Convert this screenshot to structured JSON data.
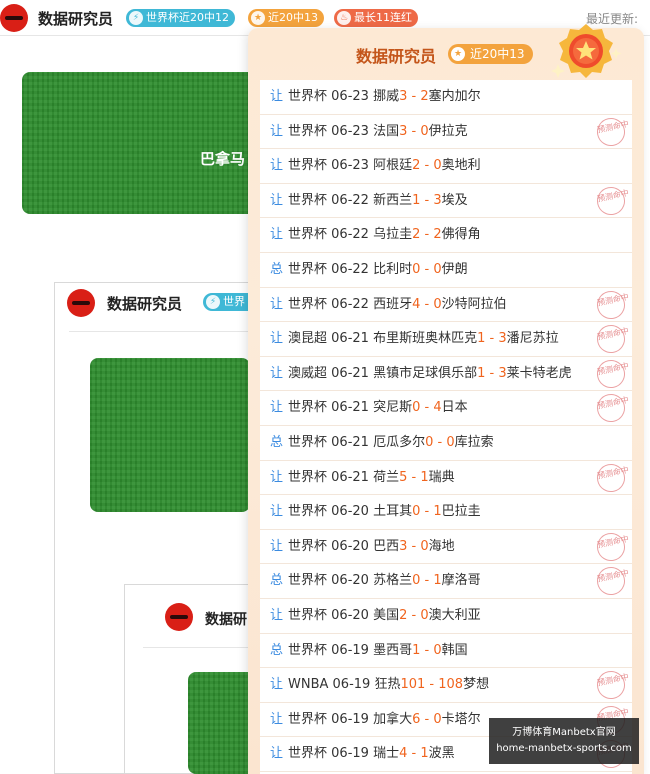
{
  "header": {
    "title": "数据研究员",
    "badges": [
      {
        "icon": "lightning-icon",
        "label": "世界杯近20中12"
      },
      {
        "icon": "star-icon",
        "label": "近20中13"
      },
      {
        "icon": "flame-icon",
        "label": "最长11连红"
      }
    ],
    "last_update": "最近更新:"
  },
  "background": {
    "banner_text": "巴拿马",
    "nested_frame_title": "数据研究员",
    "nested_frame_badge": "世界",
    "nested_frame2_title": "数据研"
  },
  "popup": {
    "title": "数据研究员",
    "badge": "近20中13",
    "stamp_text": "预测命中",
    "matches": [
      {
        "type": "让",
        "league": "世界杯",
        "date": "06-23",
        "home": "挪威",
        "hs": "3",
        "as": "2",
        "away": "塞内加尔",
        "hit": false
      },
      {
        "type": "让",
        "league": "世界杯",
        "date": "06-23",
        "home": "法国",
        "hs": "3",
        "as": "0",
        "away": "伊拉克",
        "hit": true
      },
      {
        "type": "让",
        "league": "世界杯",
        "date": "06-23",
        "home": "阿根廷",
        "hs": "2",
        "as": "0",
        "away": "奥地利",
        "hit": false
      },
      {
        "type": "让",
        "league": "世界杯",
        "date": "06-22",
        "home": "新西兰",
        "hs": "1",
        "as": "3",
        "away": "埃及",
        "hit": true
      },
      {
        "type": "让",
        "league": "世界杯",
        "date": "06-22",
        "home": "乌拉圭",
        "hs": "2",
        "as": "2",
        "away": "佛得角",
        "hit": false
      },
      {
        "type": "总",
        "league": "世界杯",
        "date": "06-22",
        "home": "比利时",
        "hs": "0",
        "as": "0",
        "away": "伊朗",
        "hit": false
      },
      {
        "type": "让",
        "league": "世界杯",
        "date": "06-22",
        "home": "西班牙",
        "hs": "4",
        "as": "0",
        "away": "沙特阿拉伯",
        "hit": true
      },
      {
        "type": "让",
        "league": "澳昆超",
        "date": "06-21",
        "home": "布里斯班奥林匹克",
        "hs": "1",
        "as": "3",
        "away": "潘尼苏拉",
        "hit": true
      },
      {
        "type": "让",
        "league": "澳威超",
        "date": "06-21",
        "home": "黑镇市足球俱乐部",
        "hs": "1",
        "as": "3",
        "away": "莱卡特老虎",
        "hit": true
      },
      {
        "type": "让",
        "league": "世界杯",
        "date": "06-21",
        "home": "突尼斯",
        "hs": "0",
        "as": "4",
        "away": "日本",
        "hit": true
      },
      {
        "type": "总",
        "league": "世界杯",
        "date": "06-21",
        "home": "厄瓜多尔",
        "hs": "0",
        "as": "0",
        "away": "库拉索",
        "hit": false
      },
      {
        "type": "让",
        "league": "世界杯",
        "date": "06-21",
        "home": "荷兰",
        "hs": "5",
        "as": "1",
        "away": "瑞典",
        "hit": true
      },
      {
        "type": "让",
        "league": "世界杯",
        "date": "06-20",
        "home": "土耳其",
        "hs": "0",
        "as": "1",
        "away": "巴拉圭",
        "hit": false
      },
      {
        "type": "让",
        "league": "世界杯",
        "date": "06-20",
        "home": "巴西",
        "hs": "3",
        "as": "0",
        "away": "海地",
        "hit": true
      },
      {
        "type": "总",
        "league": "世界杯",
        "date": "06-20",
        "home": "苏格兰",
        "hs": "0",
        "as": "1",
        "away": "摩洛哥",
        "hit": true
      },
      {
        "type": "让",
        "league": "世界杯",
        "date": "06-20",
        "home": "美国",
        "hs": "2",
        "as": "0",
        "away": "澳大利亚",
        "hit": false
      },
      {
        "type": "总",
        "league": "世界杯",
        "date": "06-19",
        "home": "墨西哥",
        "hs": "1",
        "as": "0",
        "away": "韩国",
        "hit": false
      },
      {
        "type": "让",
        "league": "WNBA",
        "date": "06-19",
        "home": "狂热",
        "hs": "101",
        "as": "108",
        "away": "梦想",
        "hit": true
      },
      {
        "type": "让",
        "league": "世界杯",
        "date": "06-19",
        "home": "加拿大",
        "hs": "6",
        "as": "0",
        "away": "卡塔尔",
        "hit": true
      },
      {
        "type": "让",
        "league": "世界杯",
        "date": "06-19",
        "home": "瑞士",
        "hs": "4",
        "as": "1",
        "away": "波黑",
        "hit": true
      }
    ]
  },
  "watermark": {
    "line1": "万博体育Manbetx官网",
    "line2": "home-manbetx-sports.com"
  },
  "colors": {
    "accent_orange": "#f0641e",
    "link_blue": "#3b8be0",
    "title_brown": "#c4561b"
  }
}
